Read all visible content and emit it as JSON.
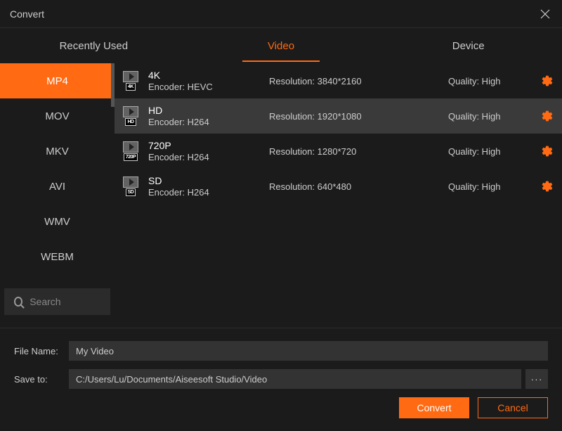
{
  "window": {
    "title": "Convert"
  },
  "tabs": [
    {
      "label": "Recently Used",
      "active": false
    },
    {
      "label": "Video",
      "active": true
    },
    {
      "label": "Device",
      "active": false
    }
  ],
  "sidebar": {
    "items": [
      {
        "label": "MP4",
        "active": true
      },
      {
        "label": "MOV",
        "active": false
      },
      {
        "label": "MKV",
        "active": false
      },
      {
        "label": "AVI",
        "active": false
      },
      {
        "label": "WMV",
        "active": false
      },
      {
        "label": "WEBM",
        "active": false
      }
    ],
    "search_placeholder": "Search"
  },
  "formats": [
    {
      "name": "4K",
      "badge": "4K",
      "encoder": "Encoder: HEVC",
      "resolution": "Resolution: 3840*2160",
      "quality": "Quality: High",
      "selected": false
    },
    {
      "name": "HD",
      "badge": "HD",
      "encoder": "Encoder: H264",
      "resolution": "Resolution: 1920*1080",
      "quality": "Quality: High",
      "selected": true
    },
    {
      "name": "720P",
      "badge": "720P",
      "encoder": "Encoder: H264",
      "resolution": "Resolution: 1280*720",
      "quality": "Quality: High",
      "selected": false
    },
    {
      "name": "SD",
      "badge": "SD",
      "encoder": "Encoder: H264",
      "resolution": "Resolution: 640*480",
      "quality": "Quality: High",
      "selected": false
    }
  ],
  "bottom": {
    "filename_label": "File Name:",
    "filename_value": "My Video",
    "saveto_label": "Save to:",
    "saveto_value": "C:/Users/Lu/Documents/Aiseesoft Studio/Video",
    "browse_label": "···",
    "convert_label": "Convert",
    "cancel_label": "Cancel"
  },
  "colors": {
    "accent": "#ff6a13",
    "bg": "#1b1b1b",
    "row_selected": "#3a3a3a"
  }
}
